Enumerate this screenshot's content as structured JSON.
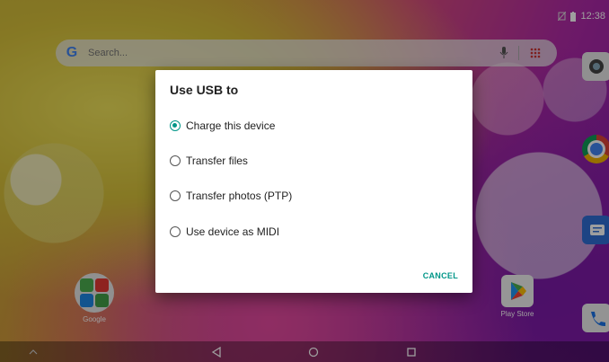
{
  "status_bar": {
    "time": "12:38"
  },
  "search": {
    "placeholder": "Search..."
  },
  "home_apps": {
    "google_label": "Google",
    "play_store_label": "Play Store"
  },
  "dialog": {
    "title": "Use USB to",
    "options": [
      {
        "label": "Charge this device",
        "selected": true
      },
      {
        "label": "Transfer files",
        "selected": false
      },
      {
        "label": "Transfer photos (PTP)",
        "selected": false
      },
      {
        "label": "Use device as MIDI",
        "selected": false
      }
    ],
    "cancel_label": "CANCEL"
  },
  "colors": {
    "accent": "#009688",
    "dialog_bg": "#ffffff"
  },
  "icons": [
    "google-g-icon",
    "mic-icon",
    "apps-grid-icon",
    "camera-icon",
    "chrome-icon",
    "messages-icon",
    "phone-icon",
    "back-icon",
    "home-icon",
    "recents-icon",
    "play-store-icon"
  ]
}
